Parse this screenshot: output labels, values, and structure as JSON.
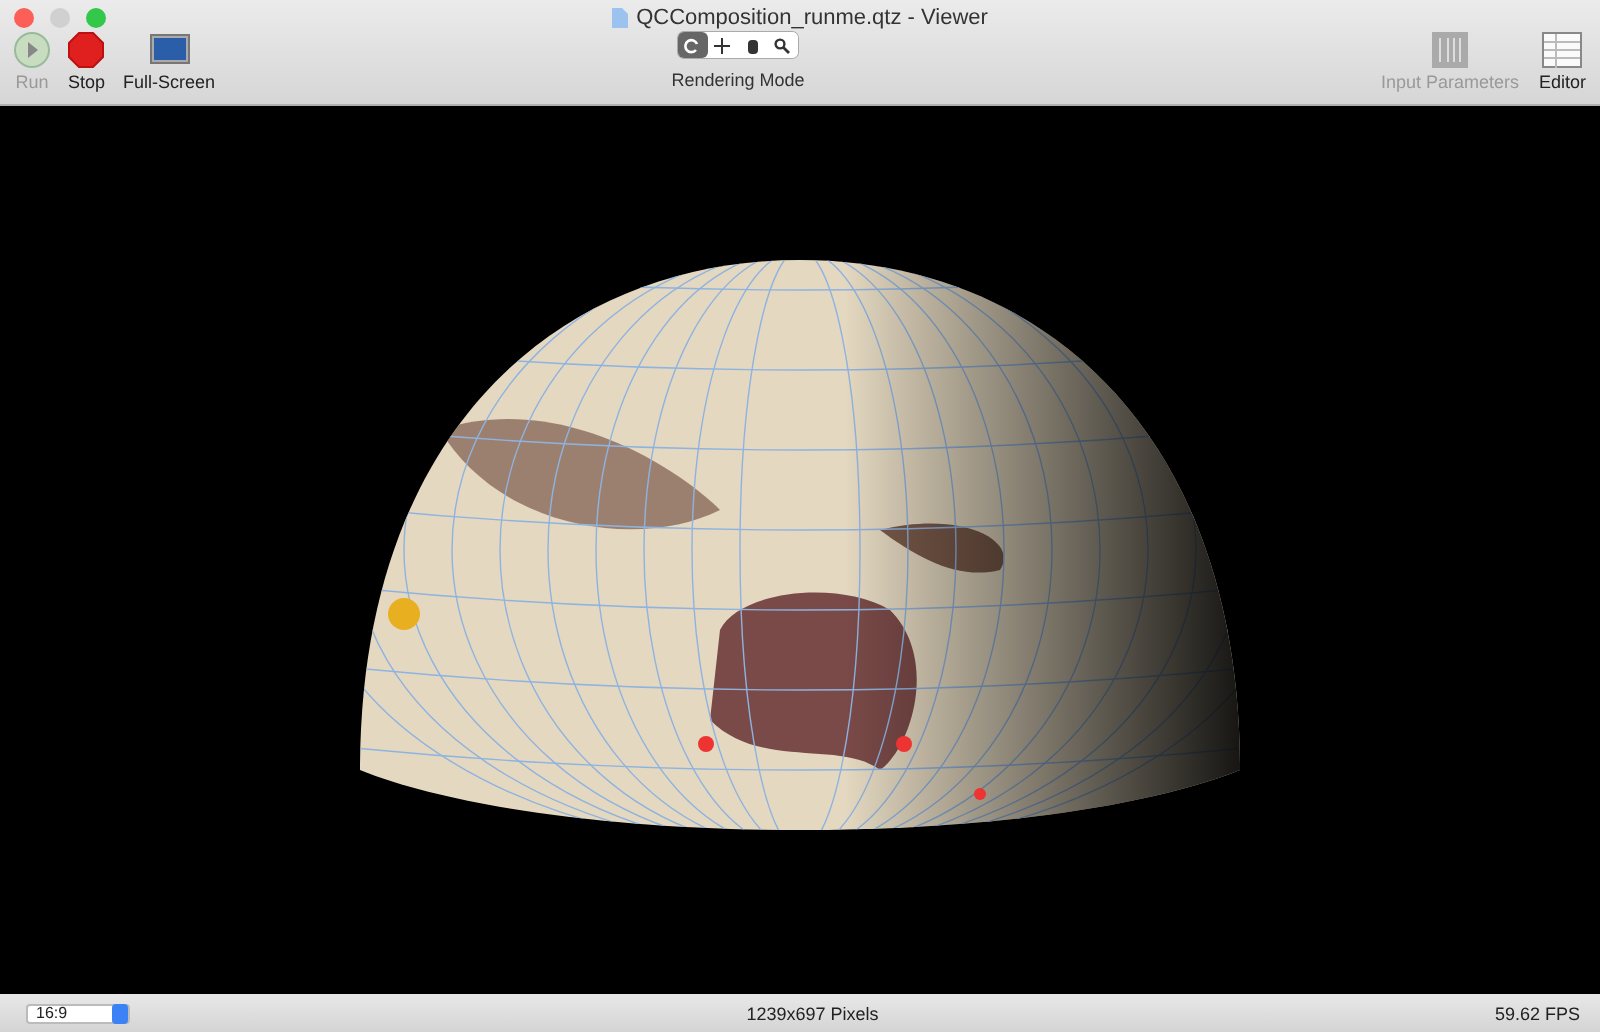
{
  "window": {
    "title": "QCComposition_runme.qtz - Viewer"
  },
  "toolbar_left": [
    {
      "kind": "run",
      "label": "Run",
      "disabled": true
    },
    {
      "kind": "stop",
      "label": "Stop",
      "disabled": false
    },
    {
      "kind": "fullscreen",
      "label": "Full-Screen",
      "disabled": false
    }
  ],
  "rendering_mode": {
    "label": "Rendering Mode",
    "modes": [
      {
        "kind": "rotate",
        "selected": true
      },
      {
        "kind": "move",
        "selected": false
      },
      {
        "kind": "hand",
        "selected": false
      },
      {
        "kind": "zoom",
        "selected": false
      }
    ]
  },
  "toolbar_right": [
    {
      "kind": "params",
      "label": "Input Parameters",
      "disabled": true
    },
    {
      "kind": "editor",
      "label": "Editor",
      "disabled": false
    }
  ],
  "status_bar": {
    "aspect": "16:9",
    "resolution": "1239x697 Pixels",
    "fps": "59.62 FPS"
  }
}
